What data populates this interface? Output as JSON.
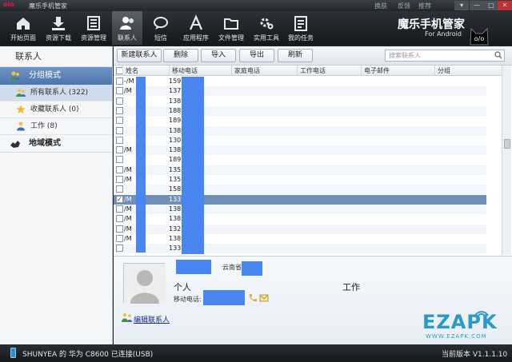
{
  "window": {
    "logo": "oio",
    "title": "魔乐手机管家",
    "skin_label": "换肤",
    "feedback_label": "反馈",
    "recommend_label": "推荐",
    "min_glyph": "—",
    "max_glyph": "□",
    "close_glyph": "✕"
  },
  "toolbar": {
    "items": [
      {
        "label": "开始页面",
        "icon": "home-icon"
      },
      {
        "label": "资源下载",
        "icon": "download-icon"
      },
      {
        "label": "资源管理",
        "icon": "resource-icon"
      },
      {
        "label": "联系人",
        "icon": "contacts-icon",
        "active": true
      },
      {
        "label": "短信",
        "icon": "sms-icon"
      },
      {
        "label": "应用程序",
        "icon": "app-icon"
      },
      {
        "label": "文件管理",
        "icon": "folder-icon"
      },
      {
        "label": "实用工具",
        "icon": "tools-icon"
      },
      {
        "label": "我的任务",
        "icon": "tasks-icon"
      }
    ],
    "brand": "魔乐手机管家",
    "brand_sub": "For Android",
    "brand_logo_text": "o/o"
  },
  "sidebar": {
    "header": "联系人",
    "group_mode": "分组模式",
    "items": [
      {
        "label": "所有联系人 (322)",
        "selected": true
      },
      {
        "label": "收藏联系人 (0)"
      },
      {
        "label": "工作 (8)"
      }
    ],
    "geo_mode": "地域模式"
  },
  "actions": {
    "new_contact": "新建联系人",
    "delete": "删除",
    "import": "导入",
    "export": "导出",
    "refresh": "刷新",
    "search_placeholder": "搜索联系人"
  },
  "table": {
    "columns": [
      "姓名",
      "移动电话",
      "家庭电话",
      "工作电话",
      "电子邮件",
      "分组"
    ],
    "rows": [
      {
        "name": "-/M",
        "phone": "159 47"
      },
      {
        "name": "/M",
        "phone": "137 72"
      },
      {
        "name": "",
        "phone": "138 97"
      },
      {
        "name": "",
        "phone": "188 30"
      },
      {
        "name": "",
        "phone": "189 43"
      },
      {
        "name": "",
        "phone": "138 18"
      },
      {
        "name": "",
        "phone": "130 80"
      },
      {
        "name": "/M",
        "phone": "138 05"
      },
      {
        "name": "",
        "phone": "189 60"
      },
      {
        "name": "/M",
        "phone": "135 80"
      },
      {
        "name": "/M",
        "phone": "135 36"
      },
      {
        "name": "",
        "phone": "158 65"
      },
      {
        "name": "/M",
        "phone": "133 06",
        "selected": true
      },
      {
        "name": "/M",
        "phone": "138 29"
      },
      {
        "name": "/M",
        "phone": "138 72"
      },
      {
        "name": "/M",
        "phone": "132 37"
      },
      {
        "name": "/M",
        "phone": "138 87"
      },
      {
        "name": "",
        "phone": "133 33"
      }
    ]
  },
  "detail": {
    "region": "云南省",
    "personal_label": "个人",
    "work_label": "工作",
    "mobile_label": "移动电话:",
    "edit_link": "编辑联系人",
    "watermark": "EZAPK",
    "watermark_url": "WWW.EZAPK.COM"
  },
  "status": {
    "device": "SHUNYEA 的 华为 C8600 已连接(USB)",
    "version": "当前版本 V1.1.1.10"
  }
}
